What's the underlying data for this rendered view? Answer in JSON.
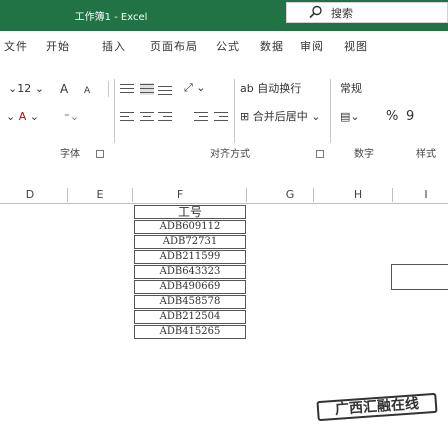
{
  "window": {
    "title": "工作簿1 - Excel"
  },
  "search": {
    "text": "搜索"
  },
  "menu": {
    "tabs": [
      "文件",
      "开始",
      "插入",
      "页面布局",
      "公式",
      "数据",
      "审阅",
      "视图"
    ]
  },
  "ribbon": {
    "font_size": "12",
    "grow_font": "A",
    "shrink_font": "A",
    "font_color": "A",
    "orientation_glyph": "ab",
    "wrap_text": "自动换行",
    "merge_center": "合并后居中",
    "number_format": "常规",
    "currency_glyph": "%",
    "comma_glyph": "9",
    "groups": [
      "字体",
      "对齐方式",
      "数字",
      "样式"
    ]
  },
  "columns": [
    "D",
    "E",
    "F",
    "G",
    "H",
    "I"
  ],
  "cells": {
    "header": "工号",
    "values": [
      "ADB609112",
      "ADB72731",
      "ADB211599",
      "ADB643323",
      "ADB490669",
      "ADB458578",
      "ADB212504",
      "ADB415265"
    ]
  },
  "watermark": {
    "text": "广西汇融在线"
  },
  "colors": {
    "title_bar": "#217346",
    "stamp_border": "#333333"
  }
}
